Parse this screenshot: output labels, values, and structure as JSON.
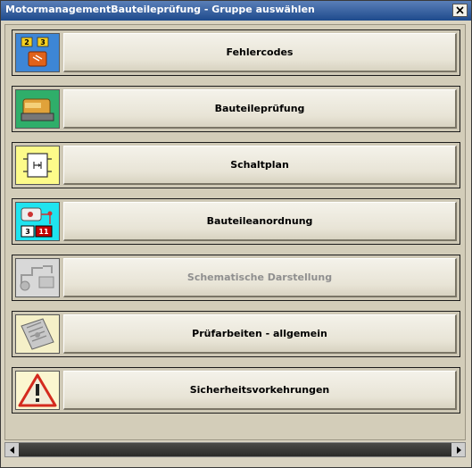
{
  "window": {
    "title": "MotormanagementBauteileprüfung - Gruppe auswählen"
  },
  "groups": [
    {
      "label": "Fehlercodes",
      "icon": "fault-codes-icon",
      "enabled": true,
      "icon_bg": "#3d86d6"
    },
    {
      "label": "Bauteileprüfung",
      "icon": "component-test-icon",
      "enabled": true,
      "icon_bg": "#2fae6a"
    },
    {
      "label": "Schaltplan",
      "icon": "wiring-diagram-icon",
      "enabled": true,
      "icon_bg": "#fdfb8a"
    },
    {
      "label": "Bauteileanordnung",
      "icon": "component-location-icon",
      "enabled": true,
      "icon_bg": "#1fe3ef",
      "icon_numbers": [
        "3",
        "11"
      ]
    },
    {
      "label": "Schematische Darstellung",
      "icon": "schematic-icon",
      "enabled": false,
      "icon_bg": "#d8d8d8"
    },
    {
      "label": "Prüfarbeiten - allgemein",
      "icon": "general-tests-icon",
      "enabled": true,
      "icon_bg": "#f5f0c8"
    },
    {
      "label": "Sicherheitsvorkehrungen",
      "icon": "warning-triangle-icon",
      "enabled": true,
      "icon_bg": "#fbf6d0"
    }
  ],
  "fault_icon_digits": [
    "2",
    "3"
  ],
  "colors": {
    "title_bar": "#1e4a8c",
    "panel": "#d3cdb9",
    "disabled_text": "#8f8f8f"
  }
}
